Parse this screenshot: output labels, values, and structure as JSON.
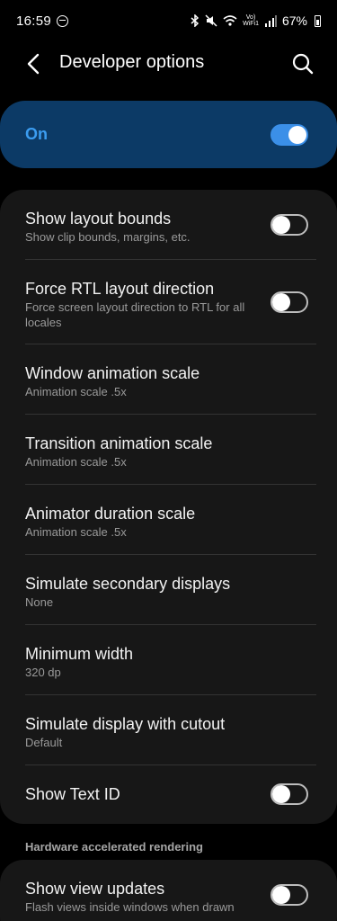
{
  "status_bar": {
    "time": "16:59",
    "volte_line1": "Vo)",
    "volte_line2": "WiFi1",
    "battery_pct": "67%"
  },
  "header": {
    "title": "Developer options"
  },
  "master_switch": {
    "label": "On",
    "on": true,
    "accent_color": "#3b8fe8"
  },
  "settings": [
    {
      "title": "Show layout bounds",
      "subtitle": "Show clip bounds, margins, etc.",
      "toggle": "off"
    },
    {
      "title": "Force RTL layout direction",
      "subtitle": "Force screen layout direction to RTL for all locales",
      "toggle": "off"
    },
    {
      "title": "Window animation scale",
      "subtitle": "Animation scale .5x"
    },
    {
      "title": "Transition animation scale",
      "subtitle": "Animation scale .5x"
    },
    {
      "title": "Animator duration scale",
      "subtitle": "Animation scale .5x"
    },
    {
      "title": "Simulate secondary displays",
      "subtitle": "None"
    },
    {
      "title": "Minimum width",
      "subtitle": "320 dp"
    },
    {
      "title": "Simulate display with cutout",
      "subtitle": "Default"
    },
    {
      "title": "Show Text ID",
      "toggle": "off"
    }
  ],
  "section_hardware": {
    "header": "Hardware accelerated rendering",
    "items": [
      {
        "title": "Show view updates",
        "subtitle": "Flash views inside windows when drawn",
        "toggle": "off"
      }
    ]
  }
}
